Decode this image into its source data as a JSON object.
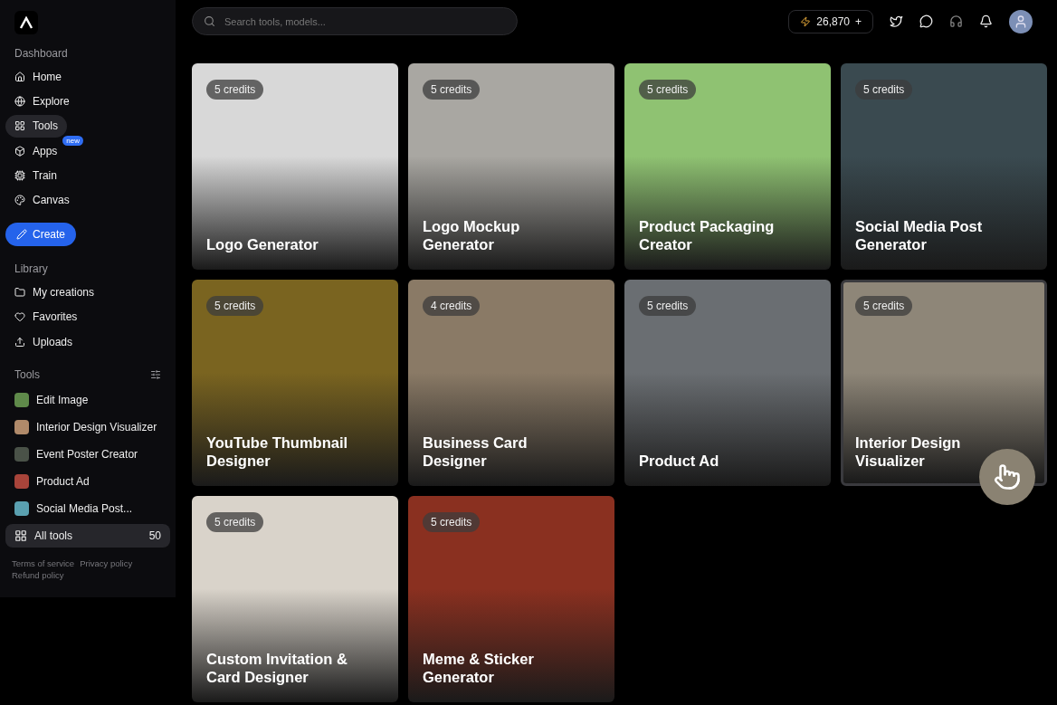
{
  "sidebar": {
    "sections": [
      {
        "heading": "Dashboard",
        "items": [
          {
            "label": "Home",
            "selected": false
          },
          {
            "label": "Explore",
            "selected": false
          },
          {
            "label": "Tools",
            "selected": true
          },
          {
            "label": "Apps",
            "selected": false,
            "badge": "new"
          },
          {
            "label": "Train",
            "selected": false
          },
          {
            "label": "Canvas",
            "selected": false
          }
        ]
      },
      {
        "heading": "Library",
        "items": [
          {
            "label": "My creations",
            "selected": false
          },
          {
            "label": "Favorites",
            "selected": false
          },
          {
            "label": "Uploads",
            "selected": false
          }
        ]
      }
    ],
    "create_button": "Create",
    "tools_heading": "Tools",
    "tools": [
      {
        "label": "Edit Image",
        "color": "#5f8a4a"
      },
      {
        "label": "Interior Design Visualizer",
        "color": "#b08a6a"
      },
      {
        "label": "Event Poster Creator",
        "color": "#4a5248"
      },
      {
        "label": "Product Ad",
        "color": "#a8443a"
      },
      {
        "label": "Social Media Post...",
        "color": "#5aa0b0"
      }
    ],
    "all_tools": {
      "label": "All tools",
      "count": "50",
      "selected": true
    },
    "footer_links": [
      "Terms of service",
      "Privacy policy",
      "Refund policy"
    ]
  },
  "topbar": {
    "search": {
      "placeholder": "Search tools, models..."
    },
    "credits": "26,870",
    "add": "+"
  },
  "cards": [
    {
      "title": "Logo Generator",
      "credits": "5 credits",
      "color": "#d8d8d8",
      "highlighted": false
    },
    {
      "title": "Logo Mockup Generator",
      "credits": "5 credits",
      "color": "#a9a7a2",
      "highlighted": false
    },
    {
      "title": "Product Packaging Creator",
      "credits": "5 credits",
      "color": "#8fc272",
      "highlighted": false
    },
    {
      "title": "Social Media Post Generator",
      "credits": "5 credits",
      "color": "#3a4a50",
      "highlighted": false
    },
    {
      "title": "YouTube Thumbnail Designer",
      "credits": "5 credits",
      "color": "#7a6420",
      "highlighted": false
    },
    {
      "title": "Business Card Designer",
      "credits": "4 credits",
      "color": "#8a7a66",
      "highlighted": false
    },
    {
      "title": "Product Ad",
      "credits": "5 credits",
      "color": "#6a6e72",
      "highlighted": false
    },
    {
      "title": "Interior Design Visualizer",
      "credits": "5 credits",
      "color": "#8e8678",
      "highlighted": true
    },
    {
      "title": "Custom Invitation & Card Designer",
      "credits": "5 credits",
      "color": "#d9d3ca",
      "highlighted": false
    },
    {
      "title": "Meme & Sticker Generator",
      "credits": "5 credits",
      "color": "#8a3020",
      "highlighted": false
    }
  ]
}
